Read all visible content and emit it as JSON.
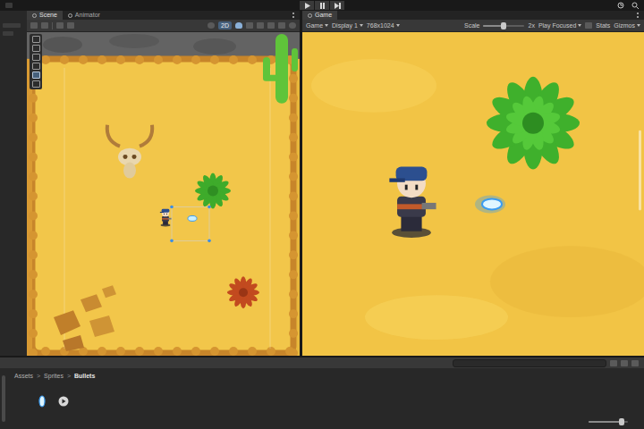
{
  "scene_panel": {
    "tabs": [
      {
        "label": "Scene",
        "selected": true
      },
      {
        "label": "Animator",
        "selected": false
      }
    ],
    "toggle_2d": {
      "label": "2D",
      "on": true
    }
  },
  "game_panel": {
    "tabs": [
      {
        "label": "Game",
        "selected": true
      }
    ],
    "view": "Game",
    "display": "Display 1",
    "resolution": "768x1024",
    "scale": {
      "label": "Scale",
      "level": 0.5,
      "value": "2x"
    },
    "play_mode": "Play Focused",
    "stats": "Stats",
    "gizmos": "Gizmos"
  },
  "project_panel": {
    "breadcrumb": [
      "Assets",
      "Sprites",
      "Bullets"
    ],
    "separator": ">",
    "assets": [
      {
        "kind": "sprite"
      },
      {
        "kind": "animation"
      }
    ],
    "zoom": {
      "level": 0.85
    }
  }
}
